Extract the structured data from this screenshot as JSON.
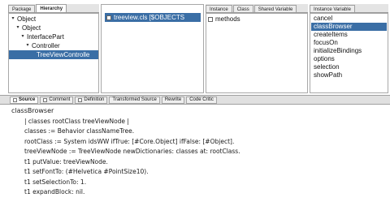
{
  "top_left_tabs": [
    "Package",
    "Hierarchy"
  ],
  "hierarchy": [
    {
      "label": "Object",
      "twisty": "▾"
    },
    {
      "label": "Object",
      "twisty": "▾"
    },
    {
      "label": "InterfacePart",
      "twisty": "▾"
    },
    {
      "label": "Controller",
      "twisty": "▾"
    },
    {
      "label": "TreeViewControlle",
      "twisty": ""
    }
  ],
  "class_pane": {
    "title": "treeview.cls [$OBJECTS"
  },
  "protocol_tabs": [
    "Instance",
    "Class",
    "Shared Variable",
    "Instance Variable"
  ],
  "protocols": [
    "methods"
  ],
  "methods": [
    "cancel",
    "classBrowser",
    "createItems",
    "focusOn",
    "initializeBindings",
    "options",
    "selection",
    "showPath"
  ],
  "code_tabs": [
    "Source",
    "Comment",
    "Definition",
    "Transformed Source",
    "Rewrite",
    "Code Critic"
  ],
  "code": [
    "classBrowser",
    "| classes rootClass treeViewNode |",
    "classes := Behavior classNameTree.",
    "rootClass := System idsWW ifTrue: [#Core.Object] ifFalse: [#Object].",
    "treeViewNode := TreeViewNode newDictionaries: classes at: rootClass.",
    "t1 putValue: treeViewNode.",
    "t1 setFontTo: (#Helvetica #PointSize10).",
    "t1 setSelectionTo: 1.",
    "t1 expandBlock: nil."
  ]
}
